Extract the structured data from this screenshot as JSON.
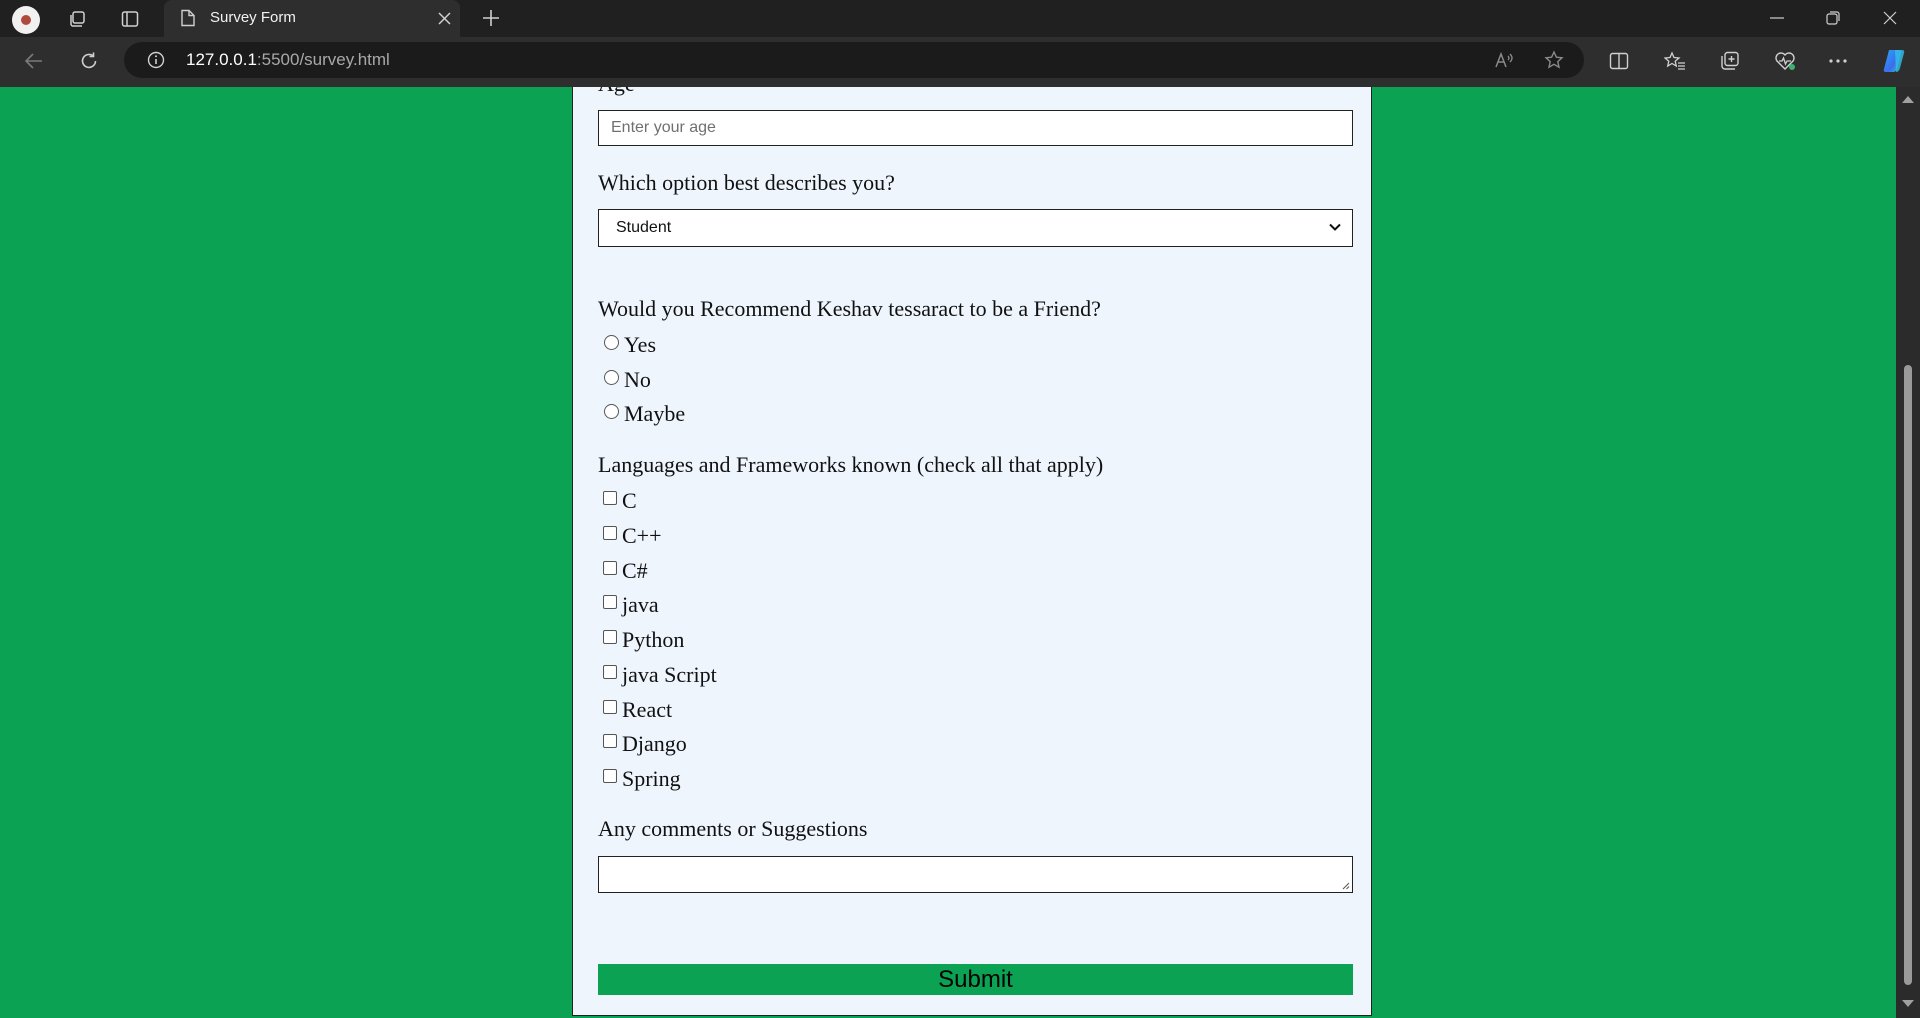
{
  "browser": {
    "tab_title": "Survey Form",
    "url_host": "127.0.0.1",
    "url_path": ":5500/survey.html"
  },
  "form": {
    "age_label": "Age",
    "age_placeholder": "Enter your age",
    "role_label": "Which option best describes you?",
    "role_selected": "Student",
    "recommend_label": "Would you Recommend Keshav tessaract to be a Friend?",
    "recommend_options": [
      "Yes",
      "No",
      "Maybe"
    ],
    "languages_label": "Languages and Frameworks known (check all that apply)",
    "languages": [
      "C",
      "C++",
      "C#",
      "java",
      "Python",
      "java Script",
      "React",
      "Django",
      "Spring"
    ],
    "comments_label": "Any comments or Suggestions",
    "submit_label": "Submit"
  },
  "colors": {
    "page_background": "#0ba254",
    "form_background": "#eef5fd",
    "submit_background": "#0ba254"
  }
}
